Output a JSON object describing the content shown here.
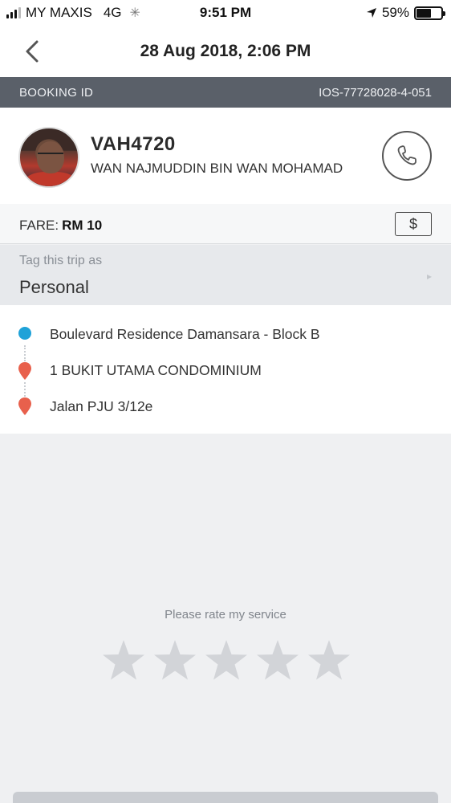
{
  "status_bar": {
    "carrier": "MY MAXIS",
    "network": "4G",
    "time": "9:51 PM",
    "battery": "59%",
    "battery_level": 0.59
  },
  "nav": {
    "title": "28 Aug 2018, 2:06 PM",
    "back_icon": "chevron-left-icon"
  },
  "booking": {
    "label": "BOOKING ID",
    "id": "IOS-77728028-4-051"
  },
  "driver": {
    "plate": "VAH4720",
    "name": "WAN NAJMUDDIN BIN WAN MOHAMAD",
    "call_icon": "phone-icon"
  },
  "fare": {
    "label": "FARE:",
    "amount": "RM 10",
    "payment_icon": "$"
  },
  "tag": {
    "hint": "Tag this trip as",
    "value": "Personal",
    "chevron_icon": "▸"
  },
  "route": {
    "stops": [
      {
        "label": "Boulevard Residence Damansara - Block B",
        "type": "pickup"
      },
      {
        "label": "1 BUKIT UTAMA CONDOMINIUM",
        "type": "dropoff"
      },
      {
        "label": "Jalan PJU 3/12e",
        "type": "dropoff"
      }
    ],
    "colors": {
      "pickup": "#1fa2d8",
      "dropoff": "#e8604c"
    }
  },
  "rating": {
    "prompt": "Please rate my service",
    "max_stars": 5,
    "selected": 0,
    "star_color": "#d2d4d8"
  },
  "colors": {
    "booking_bar": "#5a6069",
    "background": "#eff0f2"
  }
}
